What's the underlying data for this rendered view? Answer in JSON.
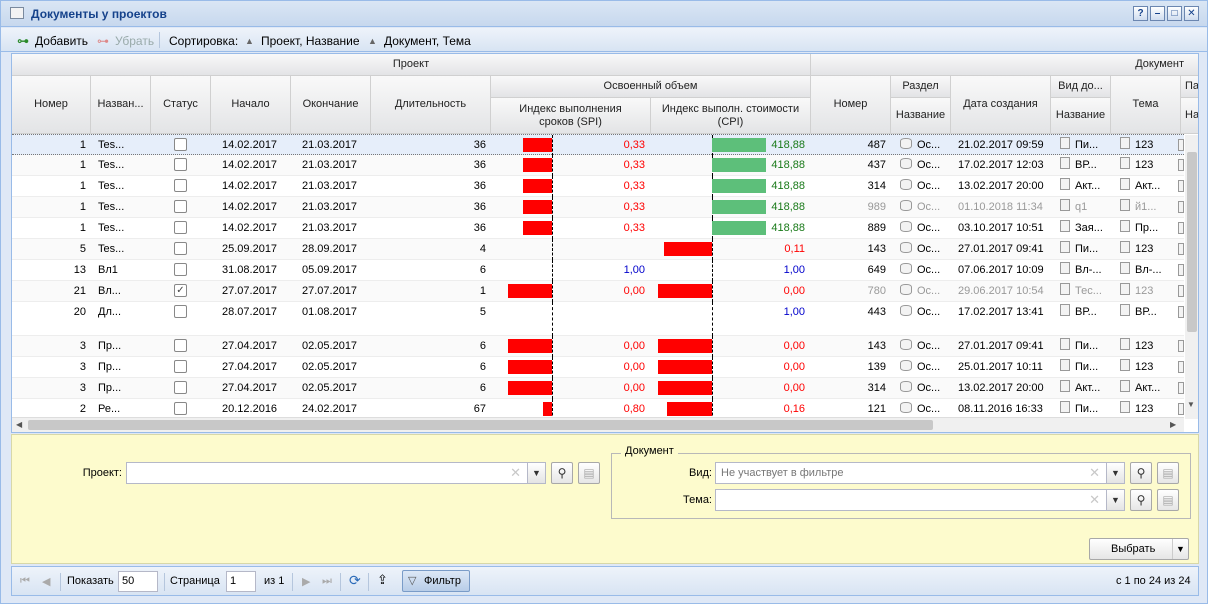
{
  "window": {
    "title": "Документы у проектов",
    "buttons": [
      "?",
      "–",
      "□",
      "✕"
    ]
  },
  "toolbar": {
    "add_label": "Добавить",
    "remove_label": "Убрать",
    "sort_label": "Сортировка:",
    "sort1": "Проект, Название",
    "sort2": "Документ, Тема"
  },
  "header": {
    "group_project": "Проект",
    "group_document": "Документ",
    "group_earned": "Освоенный объем",
    "cols": {
      "num": "Номер",
      "name": "Назван...",
      "status": "Статус",
      "start": "Начало",
      "end": "Окончание",
      "duration": "Длительность",
      "spi": "Индекс выполнения сроков (SPI)",
      "cpi": "Индекс выполн. стоимости (CPI)",
      "doc_num": "Номер",
      "section": "Раздел",
      "section_name": "Название",
      "created": "Дата создания",
      "doc_type": "Вид до...",
      "doc_type_name": "Название",
      "topic": "Тема",
      "extra": "Па",
      "extra_name": "Наз"
    }
  },
  "rows": [
    {
      "num": "1",
      "name": "Tes...",
      "checked": false,
      "start": "14.02.2017",
      "end": "21.03.2017",
      "dur": "36",
      "spi": "0,33",
      "spi_v": 0.33,
      "spi_color": "#ff0000",
      "cpi": "418,88",
      "cpi_v": 1.5,
      "cpi_color": "#1a7a1a",
      "doc_num": "487",
      "section": "Ос...",
      "created": "21.02.2017 09:59",
      "dtype": "Пи...",
      "topic": "123",
      "gray": false,
      "selected": true
    },
    {
      "num": "1",
      "name": "Tes...",
      "checked": false,
      "start": "14.02.2017",
      "end": "21.03.2017",
      "dur": "36",
      "spi": "0,33",
      "spi_v": 0.33,
      "spi_color": "#ff0000",
      "cpi": "418,88",
      "cpi_v": 1.5,
      "cpi_color": "#1a7a1a",
      "doc_num": "437",
      "section": "Ос...",
      "created": "17.02.2017 12:03",
      "dtype": "ВР...",
      "topic": "123",
      "gray": false
    },
    {
      "num": "1",
      "name": "Tes...",
      "checked": false,
      "start": "14.02.2017",
      "end": "21.03.2017",
      "dur": "36",
      "spi": "0,33",
      "spi_v": 0.33,
      "spi_color": "#ff0000",
      "cpi": "418,88",
      "cpi_v": 1.5,
      "cpi_color": "#1a7a1a",
      "doc_num": "314",
      "section": "Ос...",
      "created": "13.02.2017 20:00",
      "dtype": "Акт...",
      "topic": "Акт...",
      "gray": false
    },
    {
      "num": "1",
      "name": "Tes...",
      "checked": false,
      "start": "14.02.2017",
      "end": "21.03.2017",
      "dur": "36",
      "spi": "0,33",
      "spi_v": 0.33,
      "spi_color": "#ff0000",
      "cpi": "418,88",
      "cpi_v": 1.5,
      "cpi_color": "#1a7a1a",
      "doc_num": "989",
      "section": "Ос...",
      "created": "01.10.2018 11:34",
      "dtype": "q1",
      "topic": "й1...",
      "gray": true
    },
    {
      "num": "1",
      "name": "Tes...",
      "checked": false,
      "start": "14.02.2017",
      "end": "21.03.2017",
      "dur": "36",
      "spi": "0,33",
      "spi_v": 0.33,
      "spi_color": "#ff0000",
      "cpi": "418,88",
      "cpi_v": 1.5,
      "cpi_color": "#1a7a1a",
      "doc_num": "889",
      "section": "Ос...",
      "created": "03.10.2017 10:51",
      "dtype": "Зая...",
      "topic": "Пр...",
      "gray": false
    },
    {
      "num": "5",
      "name": "Tes...",
      "checked": false,
      "start": "25.09.2017",
      "end": "28.09.2017",
      "dur": "4",
      "spi": "",
      "spi_v": null,
      "spi_color": "#ff0000",
      "cpi": "0,11",
      "cpi_v": 0.11,
      "cpi_color": "#ff0000",
      "doc_num": "143",
      "section": "Ос...",
      "created": "27.01.2017 09:41",
      "dtype": "Пи...",
      "topic": "123",
      "gray": false
    },
    {
      "num": "13",
      "name": "Вл1",
      "checked": false,
      "start": "31.08.2017",
      "end": "05.09.2017",
      "dur": "6",
      "spi": "1,00",
      "spi_v": 1.0,
      "spi_color": "#0000cc",
      "cpi": "1,00",
      "cpi_v": 1.0,
      "cpi_color": "#0000cc",
      "doc_num": "649",
      "section": "Ос...",
      "created": "07.06.2017 10:09",
      "dtype": "Вл-...",
      "topic": "Вл-...",
      "gray": false
    },
    {
      "num": "21",
      "name": "Вл...",
      "checked": true,
      "start": "27.07.2017",
      "end": "27.07.2017",
      "dur": "1",
      "spi": "0,00",
      "spi_v": 0.0,
      "spi_color": "#ff0000",
      "cpi": "0,00",
      "cpi_v": 0.0,
      "cpi_color": "#ff0000",
      "doc_num": "780",
      "section": "Ос...",
      "created": "29.06.2017 10:54",
      "dtype": "Тес...",
      "topic": "123",
      "gray": true
    },
    {
      "num": "20",
      "name": "Дл...",
      "checked": false,
      "start": "28.07.2017",
      "end": "01.08.2017",
      "dur": "5",
      "spi": "",
      "spi_v": null,
      "spi_color": "#ff0000",
      "cpi": "1,00",
      "cpi_v": 1.0,
      "cpi_color": "#0000cc",
      "doc_num": "443",
      "section": "Ос...",
      "created": "17.02.2017 13:41",
      "dtype": "ВР...",
      "topic": "ВР...",
      "gray": false,
      "tall": true
    },
    {
      "num": "3",
      "name": "Пр...",
      "checked": false,
      "start": "27.04.2017",
      "end": "02.05.2017",
      "dur": "6",
      "spi": "0,00",
      "spi_v": 0.0,
      "spi_color": "#ff0000",
      "cpi": "0,00",
      "cpi_v": 0.0,
      "cpi_color": "#ff0000",
      "doc_num": "143",
      "section": "Ос...",
      "created": "27.01.2017 09:41",
      "dtype": "Пи...",
      "topic": "123",
      "gray": false
    },
    {
      "num": "3",
      "name": "Пр...",
      "checked": false,
      "start": "27.04.2017",
      "end": "02.05.2017",
      "dur": "6",
      "spi": "0,00",
      "spi_v": 0.0,
      "spi_color": "#ff0000",
      "cpi": "0,00",
      "cpi_v": 0.0,
      "cpi_color": "#ff0000",
      "doc_num": "139",
      "section": "Ос...",
      "created": "25.01.2017 10:11",
      "dtype": "Пи...",
      "topic": "123",
      "gray": false
    },
    {
      "num": "3",
      "name": "Пр...",
      "checked": false,
      "start": "27.04.2017",
      "end": "02.05.2017",
      "dur": "6",
      "spi": "0,00",
      "spi_v": 0.0,
      "spi_color": "#ff0000",
      "cpi": "0,00",
      "cpi_v": 0.0,
      "cpi_color": "#ff0000",
      "doc_num": "314",
      "section": "Ос...",
      "created": "13.02.2017 20:00",
      "dtype": "Акт...",
      "topic": "Акт...",
      "gray": false
    },
    {
      "num": "2",
      "name": "Ре...",
      "checked": false,
      "start": "20.12.2016",
      "end": "24.02.2017",
      "dur": "67",
      "spi": "0,80",
      "spi_v": 0.8,
      "spi_color": "#ff0000",
      "cpi": "0,16",
      "cpi_v": 0.16,
      "cpi_color": "#ff0000",
      "doc_num": "121",
      "section": "Ос...",
      "created": "08.11.2016 16:33",
      "dtype": "Пи...",
      "topic": "123",
      "gray": false
    }
  ],
  "filter": {
    "project_label": "Проект:",
    "project_value": "",
    "doc_group": "Документ",
    "type_label": "Вид:",
    "type_placeholder": "Не участвует в фильтре",
    "topic_label": "Тема:",
    "topic_value": "",
    "select_button": "Выбрать"
  },
  "pager": {
    "show_label": "Показать",
    "page_size": "50",
    "page_label": "Страница",
    "page": "1",
    "of": "из 1",
    "filter_button": "Фильтр",
    "summary": "с 1 по 24 из 24"
  },
  "colors": {
    "bar_red": "#ff0000",
    "bar_green": "#5dbf7a"
  }
}
